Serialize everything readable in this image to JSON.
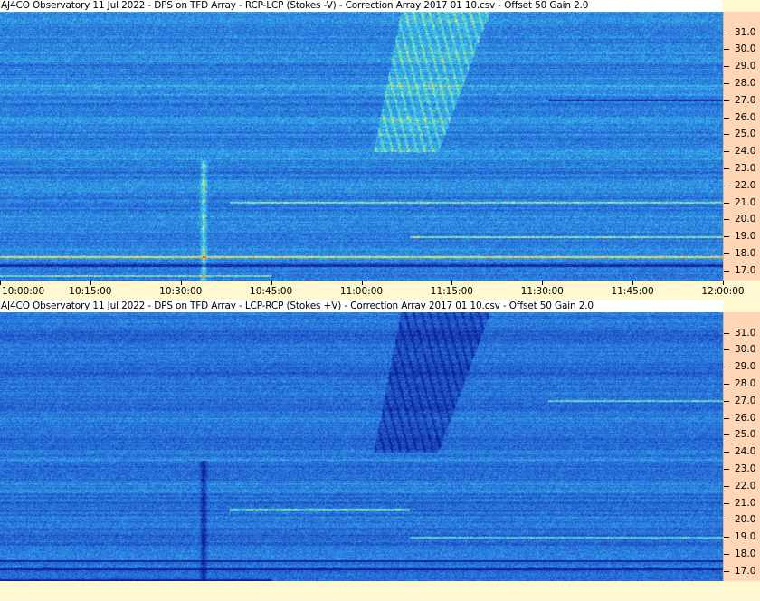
{
  "chart_data": [
    {
      "type": "heatmap",
      "title": "AJ4CO Observatory 11 Jul 2022  -  DPS on TFD Array  -  RCP-LCP (Stokes -V)  -  Correction Array 2017 01 10.csv  -  Offset 50  Gain 2.0",
      "xlabel": "",
      "ylabel": "",
      "x_ticks": [
        "10:00:00",
        "10:15:00",
        "10:30:00",
        "10:45:00",
        "11:00:00",
        "11:15:00",
        "11:30:00",
        "11:45:00",
        "12:00:00"
      ],
      "y_ticks": [
        "31.0",
        "30.0",
        "29.0",
        "28.0",
        "27.0",
        "26.0",
        "25.0",
        "24.0",
        "23.0",
        "22.0",
        "21.0",
        "20.0",
        "19.0",
        "18.0",
        "17.0"
      ],
      "xlim": [
        "10:00:00",
        "12:00:00"
      ],
      "ylim": [
        16.4,
        32.2
      ],
      "colormap": [
        "#0a1e9a",
        "#1f55c8",
        "#2f8ae6",
        "#3fd4e6",
        "#ffee55",
        "#ff3b1e"
      ],
      "features": [
        {
          "name": "drift-burst",
          "start": "11:02:00",
          "end": "11:21:00",
          "freq": [
            24.0,
            32.2
          ],
          "polarity": "positive"
        },
        {
          "name": "vertical-burst",
          "start": "10:33:00",
          "end": "10:34:30",
          "freq": [
            16.4,
            23.5
          ],
          "polarity": "positive"
        },
        {
          "name": "rfi-line",
          "start": "11:31:00",
          "end": "12:00:00",
          "freq": [
            27.0,
            27.0
          ],
          "polarity": "negative"
        },
        {
          "name": "rfi-line",
          "start": "10:00:00",
          "end": "12:00:00",
          "freq": [
            17.8,
            17.8
          ],
          "polarity": "positive"
        },
        {
          "name": "rfi-line",
          "start": "10:00:00",
          "end": "12:00:00",
          "freq": [
            17.3,
            17.3
          ],
          "polarity": "negative"
        },
        {
          "name": "rfi-line",
          "start": "10:38:00",
          "end": "12:00:00",
          "freq": [
            21.0,
            21.0
          ],
          "polarity": "positive"
        },
        {
          "name": "rfi-line",
          "start": "11:08:00",
          "end": "12:00:00",
          "freq": [
            19.0,
            19.0
          ],
          "polarity": "positive"
        },
        {
          "name": "rfi-line",
          "start": "10:00:00",
          "end": "10:45:00",
          "freq": [
            16.7,
            16.7
          ],
          "polarity": "positive"
        }
      ]
    },
    {
      "type": "heatmap",
      "title": "AJ4CO Observatory 11 Jul 2022  -  DPS on TFD Array  -  LCP-RCP (Stokes +V)  -  Correction Array 2017 01 10.csv  -  Offset 50  Gain 2.0",
      "xlabel": "",
      "ylabel": "",
      "x_ticks": [],
      "y_ticks": [
        "31.0",
        "30.0",
        "29.0",
        "28.0",
        "27.0",
        "26.0",
        "25.0",
        "24.0",
        "23.0",
        "22.0",
        "21.0",
        "20.0",
        "19.0",
        "18.0",
        "17.0"
      ],
      "xlim": [
        "10:00:00",
        "12:00:00"
      ],
      "ylim": [
        16.4,
        32.2
      ],
      "colormap": [
        "#0a1e9a",
        "#1f55c8",
        "#2f8ae6",
        "#3fd4e6",
        "#ffee55",
        "#ff3b1e"
      ],
      "features": [
        {
          "name": "drift-burst",
          "start": "11:02:00",
          "end": "11:21:00",
          "freq": [
            24.0,
            32.2
          ],
          "polarity": "negative"
        },
        {
          "name": "vertical-burst",
          "start": "10:33:00",
          "end": "10:34:30",
          "freq": [
            16.4,
            23.5
          ],
          "polarity": "negative"
        },
        {
          "name": "rfi-line",
          "start": "11:31:00",
          "end": "12:00:00",
          "freq": [
            27.0,
            27.0
          ],
          "polarity": "positive"
        },
        {
          "name": "rfi-line",
          "start": "10:00:00",
          "end": "12:00:00",
          "freq": [
            17.6,
            17.6
          ],
          "polarity": "negative"
        },
        {
          "name": "rfi-line",
          "start": "10:00:00",
          "end": "12:00:00",
          "freq": [
            17.1,
            17.1
          ],
          "polarity": "negative"
        },
        {
          "name": "rfi-line",
          "start": "11:08:00",
          "end": "12:00:00",
          "freq": [
            19.0,
            19.0
          ],
          "polarity": "positive"
        },
        {
          "name": "rfi-line",
          "start": "10:38:00",
          "end": "11:08:00",
          "freq": [
            20.6,
            20.6
          ],
          "polarity": "positive"
        },
        {
          "name": "rfi-line",
          "start": "10:00:00",
          "end": "10:45:00",
          "freq": [
            16.5,
            16.5
          ],
          "polarity": "negative"
        }
      ]
    }
  ]
}
